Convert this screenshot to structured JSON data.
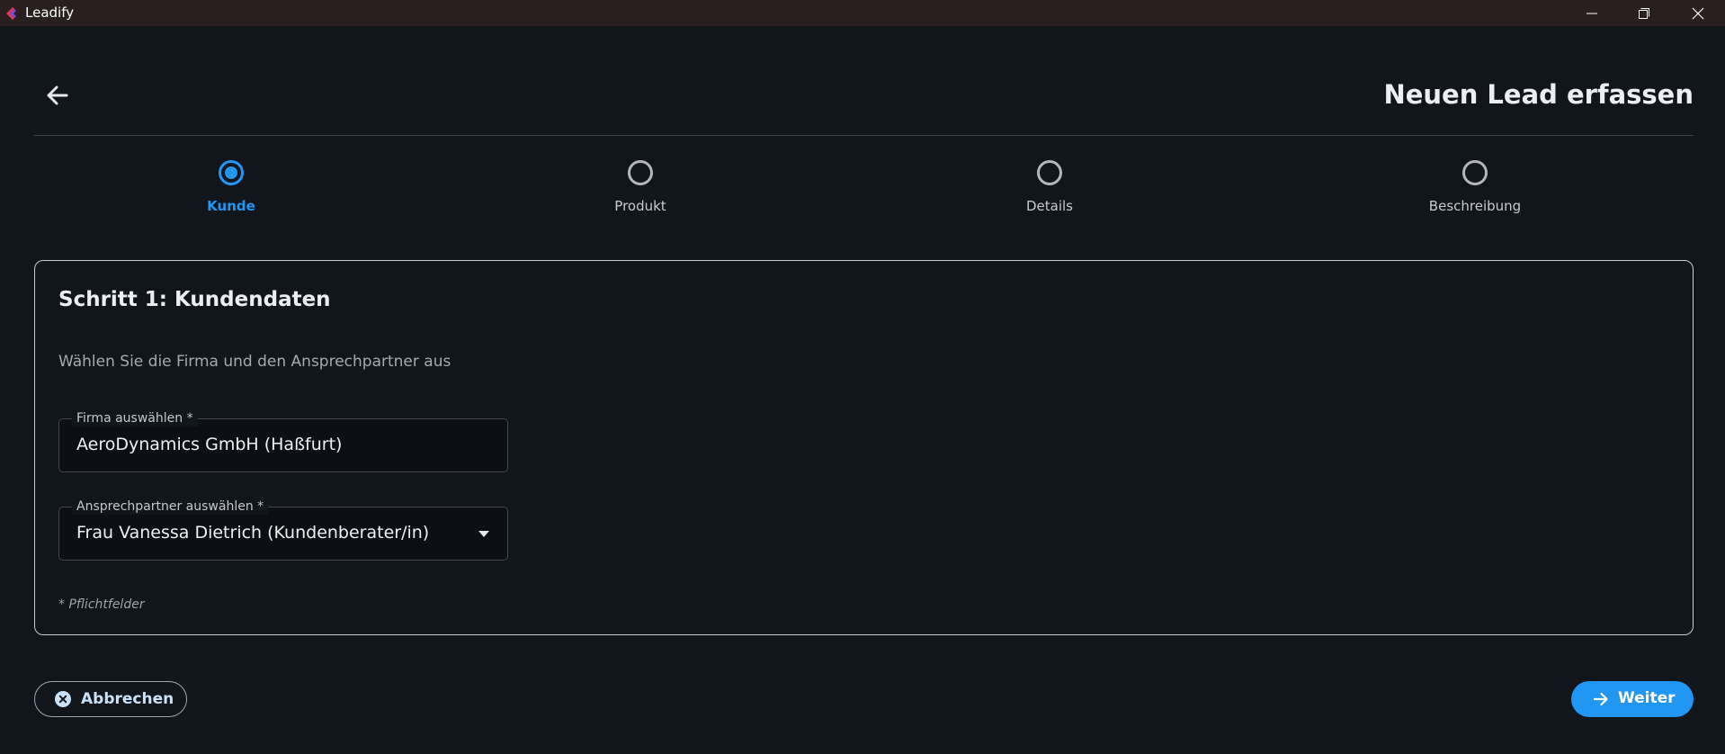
{
  "window": {
    "app_name": "Leadify",
    "controls": [
      "minimize-icon",
      "maximize-icon",
      "close-icon"
    ]
  },
  "header": {
    "back_icon": "arrow-left-icon",
    "title": "Neuen Lead erfassen"
  },
  "stepper": {
    "active_index": 0,
    "steps": [
      {
        "label": "Kunde"
      },
      {
        "label": "Produkt"
      },
      {
        "label": "Details"
      },
      {
        "label": "Beschreibung"
      }
    ]
  },
  "form": {
    "title": "Schritt 1: Kundendaten",
    "subtitle": "Wählen Sie die Firma und den Ansprechpartner aus",
    "company": {
      "label": "Firma auswählen *",
      "value": "AeroDynamics GmbH (Haßfurt)"
    },
    "contact": {
      "label": "Ansprechpartner auswählen *",
      "value": "Frau Vanessa Dietrich (Kundenberater/in)"
    },
    "required_note": "* Pflichtfelder"
  },
  "actions": {
    "cancel_label": "Abbrechen",
    "cancel_icon": "close-circle-icon",
    "next_label": "Weiter",
    "next_icon": "arrow-right-icon"
  },
  "colors": {
    "accent": "#2196f3",
    "background": "#11151c",
    "titlebar": "#2a1f1f"
  }
}
